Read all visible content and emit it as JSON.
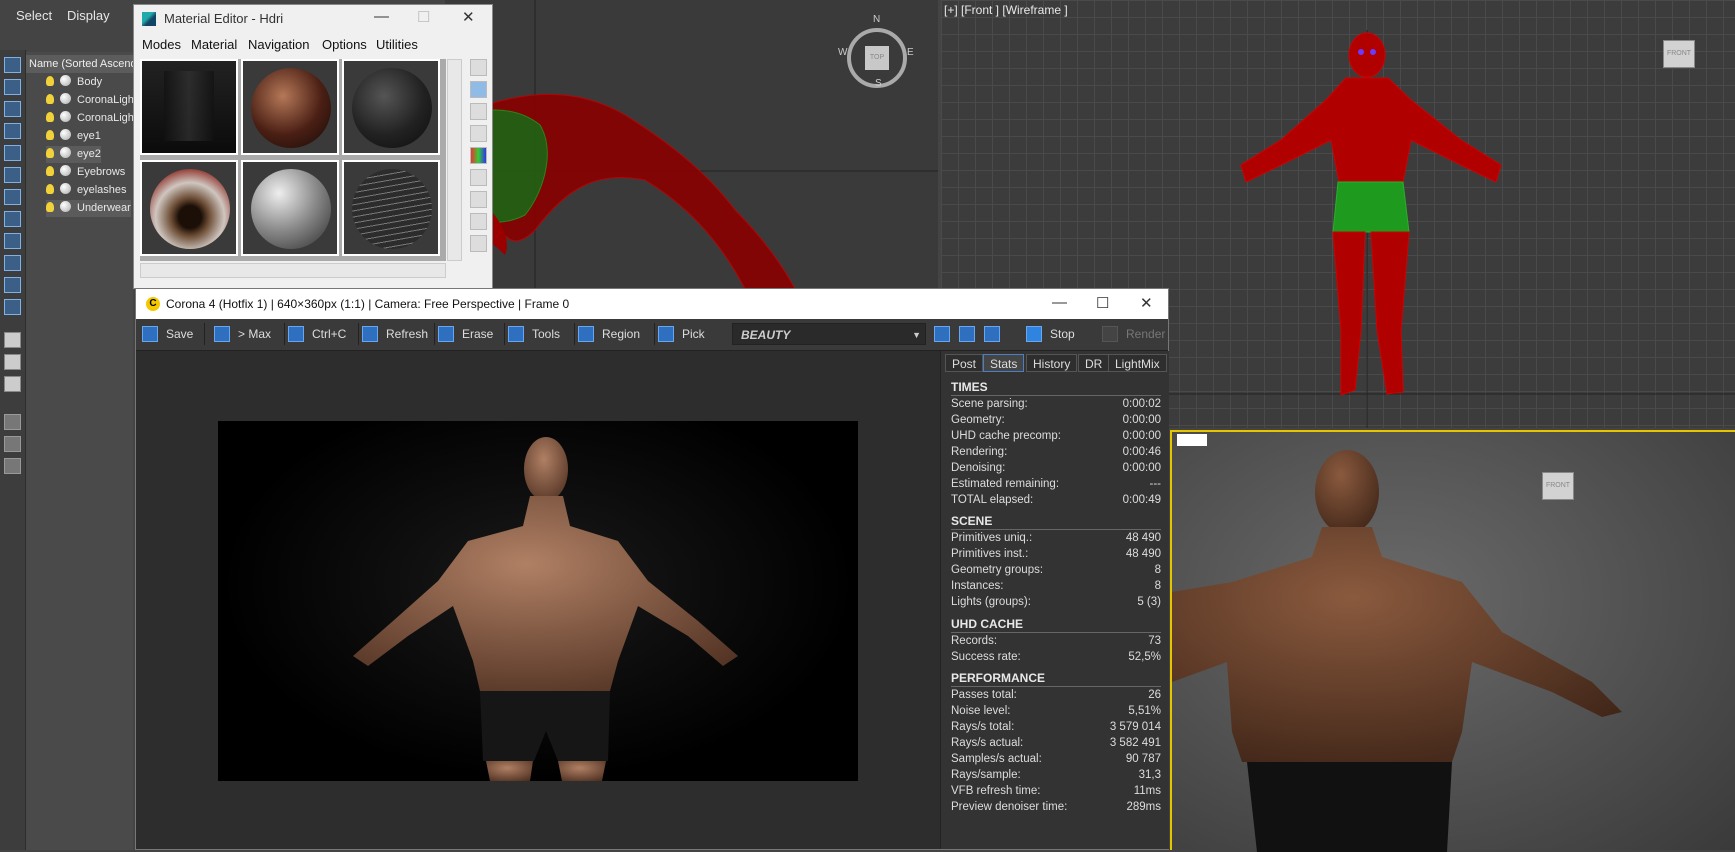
{
  "max": {
    "menu": [
      "Select",
      "Display"
    ],
    "explorer": {
      "header": "Name (Sorted Ascending)",
      "items": [
        "Body",
        "CoronaLight",
        "CoronaLight",
        "eye1",
        "eye2",
        "Eyebrows",
        "eyelashes",
        "Underwear"
      ]
    },
    "front_viewport_label": "[+] [Front ] [Wireframe ]",
    "compass": {
      "n": "N",
      "s": "S",
      "e": "E",
      "w": "W",
      "center": "TOP"
    },
    "navcube_labels": [
      "FRONT",
      "FRONT"
    ]
  },
  "material_editor": {
    "title": "Material Editor - Hdri",
    "menus": [
      "Modes",
      "Material",
      "Navigation",
      "Options",
      "Utilities"
    ],
    "slots": [
      "hdri-room",
      "skin-sphere",
      "dark-cloth",
      "eye-sphere",
      "glass-sphere",
      "wire-sphere"
    ]
  },
  "vfb": {
    "title": "Corona 4 (Hotfix 1) | 640×360px (1:1) | Camera: Free Perspective | Frame 0",
    "toolbar": {
      "save": "Save",
      "to_max": "> Max",
      "copy": "Ctrl+C",
      "refresh": "Refresh",
      "erase": "Erase",
      "tools": "Tools",
      "region": "Region",
      "pick": "Pick",
      "channel": "BEAUTY",
      "stop": "Stop",
      "render": "Render"
    },
    "tabs": [
      "Post",
      "Stats",
      "History",
      "DR",
      "LightMix"
    ],
    "active_tab": "Stats",
    "stats": {
      "times": {
        "title": "TIMES",
        "rows": [
          {
            "label": "Scene parsing:",
            "value": "0:00:02"
          },
          {
            "label": "Geometry:",
            "value": "0:00:00"
          },
          {
            "label": "UHD cache precomp:",
            "value": "0:00:00"
          },
          {
            "label": "Rendering:",
            "value": "0:00:46"
          },
          {
            "label": "Denoising:",
            "value": "0:00:00"
          },
          {
            "label": "Estimated remaining:",
            "value": "---"
          },
          {
            "label": "TOTAL elapsed:",
            "value": "0:00:49"
          }
        ]
      },
      "scene": {
        "title": "SCENE",
        "rows": [
          {
            "label": "Primitives uniq.:",
            "value": "48 490"
          },
          {
            "label": "Primitives inst.:",
            "value": "48 490"
          },
          {
            "label": "Geometry groups:",
            "value": "8"
          },
          {
            "label": "Instances:",
            "value": "8"
          },
          {
            "label": "Lights (groups):",
            "value": "5 (3)"
          }
        ]
      },
      "uhd": {
        "title": "UHD CACHE",
        "rows": [
          {
            "label": "Records:",
            "value": "73"
          },
          {
            "label": "Success rate:",
            "value": "52,5%"
          }
        ]
      },
      "performance": {
        "title": "PERFORMANCE",
        "rows": [
          {
            "label": "Passes total:",
            "value": "26"
          },
          {
            "label": "Noise level:",
            "value": "5,51%"
          },
          {
            "label": "Rays/s total:",
            "value": "3 579 014"
          },
          {
            "label": "Rays/s actual:",
            "value": "3 582 491"
          },
          {
            "label": "Samples/s actual:",
            "value": "90 787"
          },
          {
            "label": "Rays/sample:",
            "value": "31,3"
          },
          {
            "label": "VFB refresh time:",
            "value": "11ms"
          },
          {
            "label": "Preview denoiser time:",
            "value": "289ms"
          }
        ]
      }
    }
  },
  "colors": {
    "accent": "#2f6fbf",
    "wire_red": "#b00000",
    "wire_green": "#1e9a1e",
    "highlight": "#e5c400"
  }
}
